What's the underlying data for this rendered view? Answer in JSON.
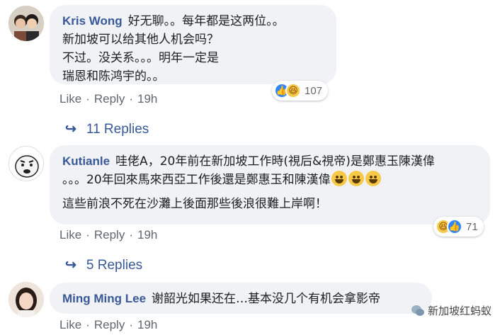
{
  "comments": [
    {
      "author": "Kris Wong",
      "lines": [
        "好无聊。。每年都是这两位。。",
        "新加坡可以给其他人机会吗？",
        "不过。没关系。。。明年一定是",
        "瑞恩和陈鸿宇的。。"
      ],
      "reaction_count": "107",
      "reaction_icons": [
        "like-icon",
        "haha-icon"
      ],
      "like_label": "Like",
      "reply_label": "Reply",
      "time": "19h",
      "replies_label": "11 Replies"
    },
    {
      "author": "Kutianle",
      "lines": [
        "哇佬A，20年前在新加坡工作時(視后&視帝)是鄭惠玉陳漢偉",
        "。。。20年回來馬來西亞工作後還是鄭惠玉和陳漢偉",
        "這些前浪不死在沙灘上後面那些後浪很難上岸啊！"
      ],
      "reaction_count": "71",
      "reaction_icons": [
        "haha-icon",
        "like-icon"
      ],
      "like_label": "Like",
      "reply_label": "Reply",
      "time": "19h",
      "replies_label": "5 Replies"
    },
    {
      "author": "Ming Ming Lee",
      "lines": [
        "谢韶光如果还在…基本没几个有机会拿影帝"
      ],
      "like_label": "Like",
      "reply_label": "Reply",
      "time": "19h"
    }
  ],
  "watermark": "新加坡红蚂蚁",
  "colors": {
    "link": "#385898",
    "bubble": "#f0f2f5",
    "like": "#2d88ff",
    "haha": "#f7c948"
  }
}
